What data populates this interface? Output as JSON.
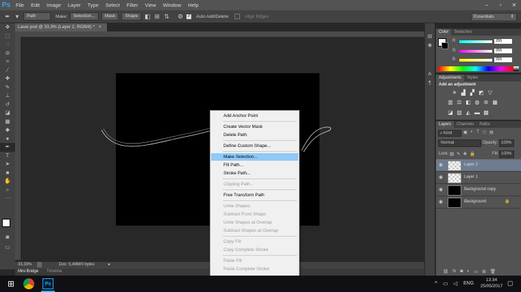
{
  "app": {
    "logo": "Ps"
  },
  "menubar": {
    "items": [
      "File",
      "Edit",
      "Image",
      "Layer",
      "Type",
      "Select",
      "Filter",
      "View",
      "Window",
      "Help"
    ]
  },
  "options": {
    "mode": "Path",
    "make_label": "Make:",
    "selection_btn": "Selection...",
    "mask_btn": "Mask",
    "shape_btn": "Shape",
    "auto_add_delete": "Auto Add/Delete",
    "align_edges": "Align Edges",
    "workspace": "Essentials"
  },
  "document": {
    "tab_title": "Laser.psd @ 33,3% (Layer 2, RGB/8) *",
    "zoom": "33,33%",
    "doc_info": "Doc: 5,49M/0 bytes"
  },
  "bottom_tabs": [
    "Mini Bridge",
    "Timeline"
  ],
  "color_panel": {
    "tabs": [
      "Color",
      "Swatches"
    ],
    "channels": [
      {
        "label": "R",
        "value": "255"
      },
      {
        "label": "G",
        "value": "255"
      },
      {
        "label": "B",
        "value": "255"
      }
    ]
  },
  "adjustments_panel": {
    "tabs": [
      "Adjustments",
      "Styles"
    ],
    "heading": "Add an adjustment"
  },
  "layers_panel": {
    "tabs": [
      "Layers",
      "Channels",
      "Paths"
    ],
    "kind_filter": "Kind",
    "blend_mode": "Normal",
    "opacity_label": "Opacity:",
    "opacity_value": "100%",
    "lock_label": "Lock:",
    "fill_label": "Fill:",
    "fill_value": "100%",
    "layers": [
      {
        "name": "Layer 2",
        "selected": true,
        "thumb": "transparent"
      },
      {
        "name": "Layer 1",
        "selected": false,
        "thumb": "transparent"
      },
      {
        "name": "Background copy",
        "selected": false,
        "thumb": "black"
      },
      {
        "name": "Background",
        "selected": false,
        "thumb": "black",
        "italic": true
      }
    ]
  },
  "context_menu": {
    "items": [
      {
        "label": "Add Anchor Point",
        "enabled": true
      },
      {
        "label": "Create Vector Mask",
        "enabled": true
      },
      {
        "label": "Delete Path",
        "enabled": true
      },
      {
        "label": "Define Custom Shape...",
        "enabled": true
      },
      {
        "label": "Make Selection...",
        "enabled": true,
        "highlighted": true
      },
      {
        "label": "Fill Path...",
        "enabled": true
      },
      {
        "label": "Stroke Path...",
        "enabled": true
      },
      {
        "label": "Clipping Path...",
        "enabled": false
      },
      {
        "label": "Free Transform Path",
        "enabled": true
      },
      {
        "label": "Unite Shapes",
        "enabled": false
      },
      {
        "label": "Subtract Front Shape",
        "enabled": false
      },
      {
        "label": "Unite Shapes at Overlap",
        "enabled": false
      },
      {
        "label": "Subtract Shapes at Overlap",
        "enabled": false
      },
      {
        "label": "Copy Fill",
        "enabled": false
      },
      {
        "label": "Copy Complete Stroke",
        "enabled": false
      },
      {
        "label": "Paste Fill",
        "enabled": false
      },
      {
        "label": "Paste Complete Stroke",
        "enabled": false
      }
    ]
  },
  "taskbar": {
    "time": "13:34",
    "date": "25/05/2017",
    "language": "ENG",
    "ps_label": "Ps"
  }
}
